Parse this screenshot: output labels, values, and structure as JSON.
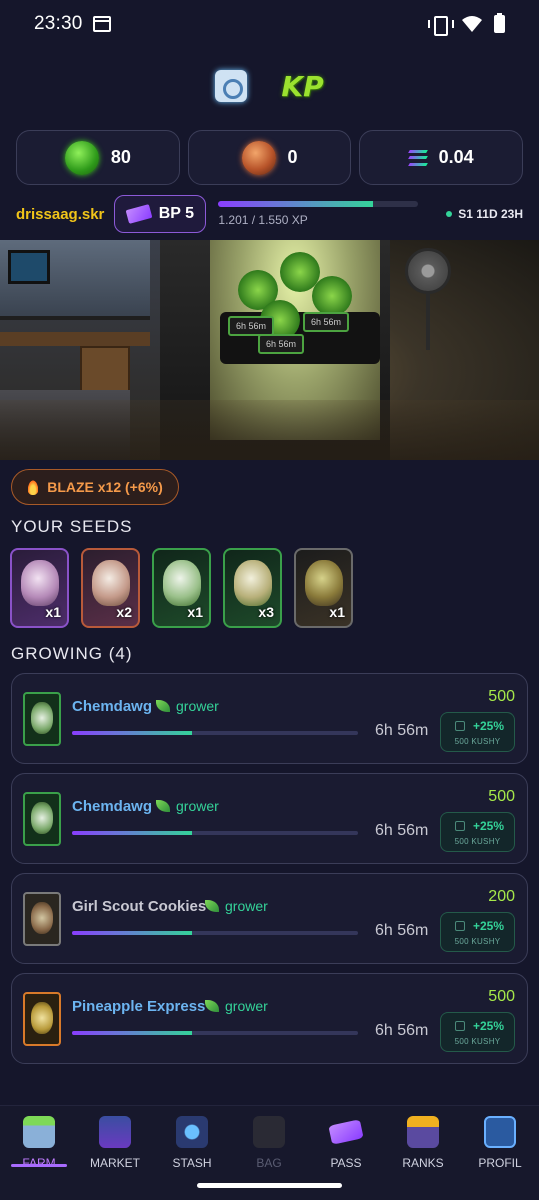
{
  "status_bar": {
    "time": "23:30"
  },
  "balances": [
    {
      "icon": "kp-coin-icon",
      "value": "80"
    },
    {
      "icon": "bronze-coin-icon",
      "value": "0"
    },
    {
      "icon": "solana-icon",
      "value": "0.04"
    }
  ],
  "user": {
    "name": "drissaag.skr",
    "bp_label": "BP 5",
    "xp_text": "1.201 / 1.550 XP",
    "xp_progress": 0.775,
    "season": "S1 11D 23H"
  },
  "scene": {
    "pot_labels": [
      "6h 56m",
      "6h 56m",
      "6h 56m"
    ]
  },
  "blaze": {
    "label": "BLAZE x12 (+6%)"
  },
  "seeds": {
    "title": "YOUR SEEDS",
    "items": [
      {
        "rarity": "purple",
        "qty": "x1"
      },
      {
        "rarity": "orange",
        "qty": "x2"
      },
      {
        "rarity": "green",
        "qty": "x1"
      },
      {
        "rarity": "green",
        "qty": "x3"
      },
      {
        "rarity": "dark",
        "qty": "x1"
      }
    ]
  },
  "growing": {
    "title": "GROWING (4)",
    "items": [
      {
        "name": "Chemdawg",
        "role": "grower",
        "time": "6h 56m",
        "reward": "500",
        "boost": "+25%",
        "boost_sub": "500 KUSHY",
        "progress": 0.42
      },
      {
        "name": "Chemdawg",
        "role": "grower",
        "time": "6h 56m",
        "reward": "500",
        "boost": "+25%",
        "boost_sub": "500 KUSHY",
        "progress": 0.42
      },
      {
        "name": "Girl Scout Cookies",
        "role": "grower",
        "time": "6h 56m",
        "reward": "200",
        "boost": "+25%",
        "boost_sub": "500 KUSHY",
        "progress": 0.42
      },
      {
        "name": "Pineapple Express",
        "role": "grower",
        "time": "6h 56m",
        "reward": "500",
        "boost": "+25%",
        "boost_sub": "500 KUSHY",
        "progress": 0.42
      }
    ]
  },
  "nav": {
    "items": [
      {
        "label": "FARM",
        "state": "active"
      },
      {
        "label": "MARKET",
        "state": "normal"
      },
      {
        "label": "STASH",
        "state": "normal"
      },
      {
        "label": "BAG",
        "state": "disabled"
      },
      {
        "label": "PASS",
        "state": "normal"
      },
      {
        "label": "RANKS",
        "state": "normal"
      },
      {
        "label": "PROFIL",
        "state": "normal"
      }
    ]
  },
  "colors": {
    "background": "#15162b",
    "accent_purple": "#a86bff",
    "accent_green": "#34d399",
    "username_gold": "#f0c419",
    "reward_green": "#a6e84a",
    "blaze_orange": "#f59a4a"
  }
}
